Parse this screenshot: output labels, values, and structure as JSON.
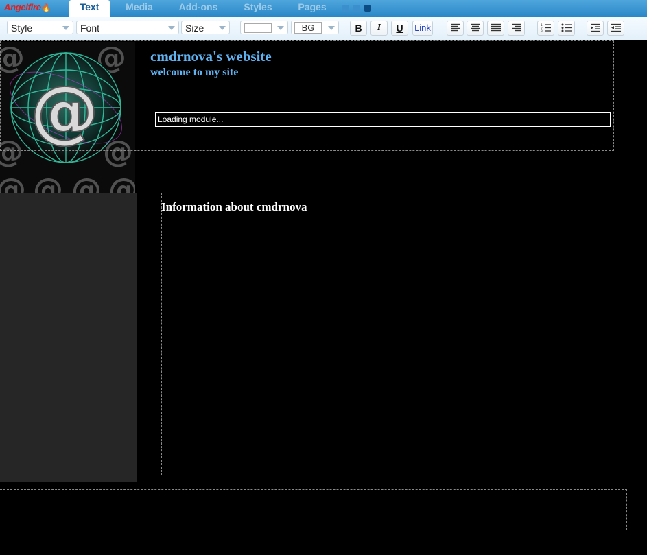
{
  "app": {
    "logo": "Angelfire"
  },
  "tabs": [
    {
      "label": "Text",
      "active": true
    },
    {
      "label": "Media"
    },
    {
      "label": "Add-ons"
    },
    {
      "label": "Styles"
    },
    {
      "label": "Pages"
    }
  ],
  "toolbar": {
    "style": "Style",
    "font": "Font",
    "size": "Size",
    "bg": "BG",
    "bold": "B",
    "italic": "I",
    "underline": "U",
    "link": "Link"
  },
  "page": {
    "site_title": "cmdrnova's website",
    "site_subtitle": "welcome to my site",
    "loading_text": "Loading module...",
    "info_title": "Information about cmdrnova"
  },
  "colors": {
    "title_blue": "#5fb3f2",
    "tab_active_text": "#1b5f99",
    "background": "#000000"
  }
}
